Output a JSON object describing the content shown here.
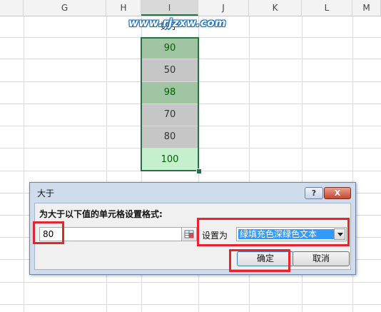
{
  "sheet": {
    "columns": [
      "G",
      "H",
      "I",
      "J",
      "K",
      "L",
      "M"
    ],
    "selected_column": "I",
    "header_label": "数字",
    "values": [
      "90",
      "50",
      "98",
      "70",
      "80",
      "100"
    ]
  },
  "watermark": "www.rjzxw.com",
  "dialog": {
    "title": "大于",
    "help_label": "?",
    "close_label": "X",
    "prompt": "为大于以下值的单元格设置格式:",
    "value": "80",
    "set_label": "设置为",
    "format_value": "绿填充色深绿色文本",
    "ok_label": "确定",
    "cancel_label": "取消"
  },
  "colors": {
    "dark_green_fill": "#a1c4a2",
    "gray_fill": "#c6c6c6",
    "light_green_fill": "#c6efce",
    "dark_green_text": "#006100",
    "selection_border": "#217346",
    "annotation_red": "#e5252d",
    "dropdown_highlight": "#3399ff"
  }
}
